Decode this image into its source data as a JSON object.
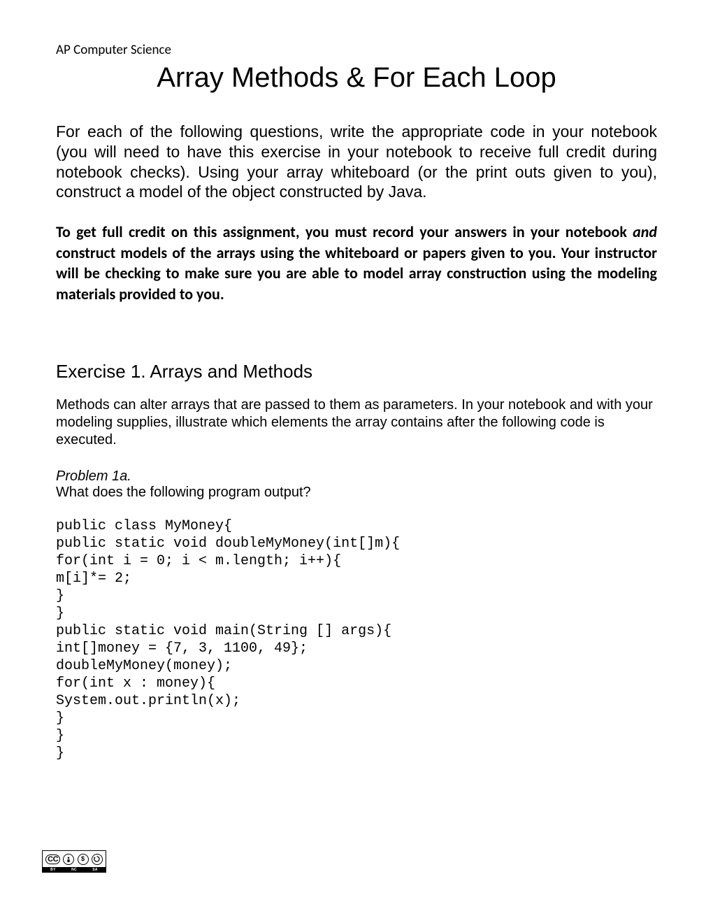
{
  "header": {
    "course": "AP Computer Science"
  },
  "title": "Array Methods & For Each Loop",
  "intro": "For each of the following questions, write the appropriate code in your notebook (you will need to have this exercise in your notebook to receive full credit during notebook checks).  Using your array whiteboard (or the print outs given to you), construct a model of the object constructed by Java.",
  "credit_note": {
    "line1": "To get full credit on this assignment, you must record your answers in your notebook ",
    "and": "and",
    "line2": " construct models of the arrays using the whiteboard or papers given to you.  Your instructor will be checking to make sure you are able to model array construction using the modeling materials provided to you."
  },
  "exercise": {
    "title": "Exercise 1. Arrays and Methods",
    "desc": "Methods can alter arrays that are passed to them as parameters. In your notebook and with your modeling supplies, illustrate which elements the array contains after the following code is executed.",
    "problem_label": "Problem 1a.",
    "problem_q": "What does the following program output?",
    "code": "public class MyMoney{\npublic static void doubleMyMoney(int[]m){\nfor(int i = 0; i < m.length; i++){\nm[i]*= 2;\n}\n}\npublic static void main(String [] args){\nint[]money = {7, 3, 1100, 49};\ndoubleMyMoney(money);\nfor(int x : money){\nSystem.out.println(x);\n}\n}\n}"
  },
  "license": {
    "cc": "CC",
    "by": "BY",
    "nc": "NC",
    "sa": "SA"
  }
}
